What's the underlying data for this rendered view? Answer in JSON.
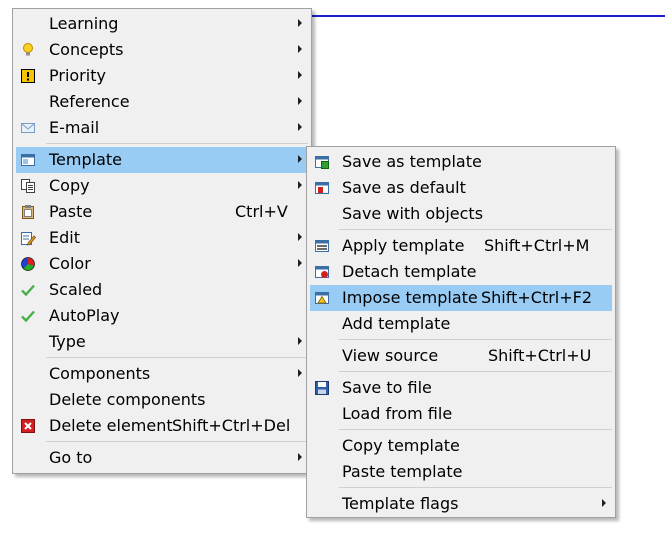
{
  "main_menu": {
    "items": [
      {
        "label": "Learning",
        "icon": "blank",
        "submenu": true
      },
      {
        "label": "Concepts",
        "icon": "lightbulb-icon",
        "submenu": true
      },
      {
        "label": "Priority",
        "icon": "priority-icon",
        "submenu": true
      },
      {
        "label": "Reference",
        "icon": "blank",
        "submenu": true
      },
      {
        "label": "E-mail",
        "icon": "email-icon",
        "submenu": true
      },
      {
        "label": "Template",
        "icon": "template-icon",
        "submenu": true,
        "highlighted": true
      },
      {
        "label": "Copy",
        "icon": "copy-icon",
        "submenu": true
      },
      {
        "label": "Paste",
        "icon": "paste-icon",
        "shortcut": "Ctrl+V"
      },
      {
        "label": "Edit",
        "icon": "edit-icon",
        "submenu": true
      },
      {
        "label": "Color",
        "icon": "color-icon",
        "submenu": true
      },
      {
        "label": "Scaled",
        "icon": "check-icon",
        "checked": true
      },
      {
        "label": "AutoPlay",
        "icon": "check-icon",
        "checked": true
      },
      {
        "label": "Type",
        "icon": "blank",
        "submenu": true
      },
      {
        "label": "Components",
        "icon": "blank",
        "submenu": true
      },
      {
        "label": "Delete components",
        "icon": "blank"
      },
      {
        "label": "Delete element",
        "icon": "delete-icon",
        "shortcut": "Shift+Ctrl+Del"
      },
      {
        "label": "Go to",
        "icon": "blank",
        "submenu": true
      }
    ]
  },
  "sub_menu": {
    "items": [
      {
        "label": "Save as template",
        "icon": "save-template-icon"
      },
      {
        "label": "Save as default",
        "icon": "save-default-icon"
      },
      {
        "label": "Save with objects",
        "icon": "blank"
      },
      {
        "label": "Apply template",
        "icon": "apply-template-icon",
        "shortcut": "Shift+Ctrl+M"
      },
      {
        "label": "Detach template",
        "icon": "detach-template-icon"
      },
      {
        "label": "Impose template",
        "icon": "impose-template-icon",
        "shortcut": "Shift+Ctrl+F2",
        "highlighted": true
      },
      {
        "label": "Add template",
        "icon": "blank"
      },
      {
        "label": "View source",
        "icon": "blank",
        "shortcut": "Shift+Ctrl+U"
      },
      {
        "label": "Save to file",
        "icon": "floppy-icon"
      },
      {
        "label": "Load from file",
        "icon": "blank"
      },
      {
        "label": "Copy template",
        "icon": "blank"
      },
      {
        "label": "Paste template",
        "icon": "blank"
      },
      {
        "label": "Template flags",
        "icon": "blank",
        "submenu": true
      }
    ]
  },
  "colors": {
    "menu_background": "#f0f0f0",
    "highlight": "#99ccf4",
    "separator": "#d0d0d0",
    "accent_line": "#1f1fd0"
  }
}
